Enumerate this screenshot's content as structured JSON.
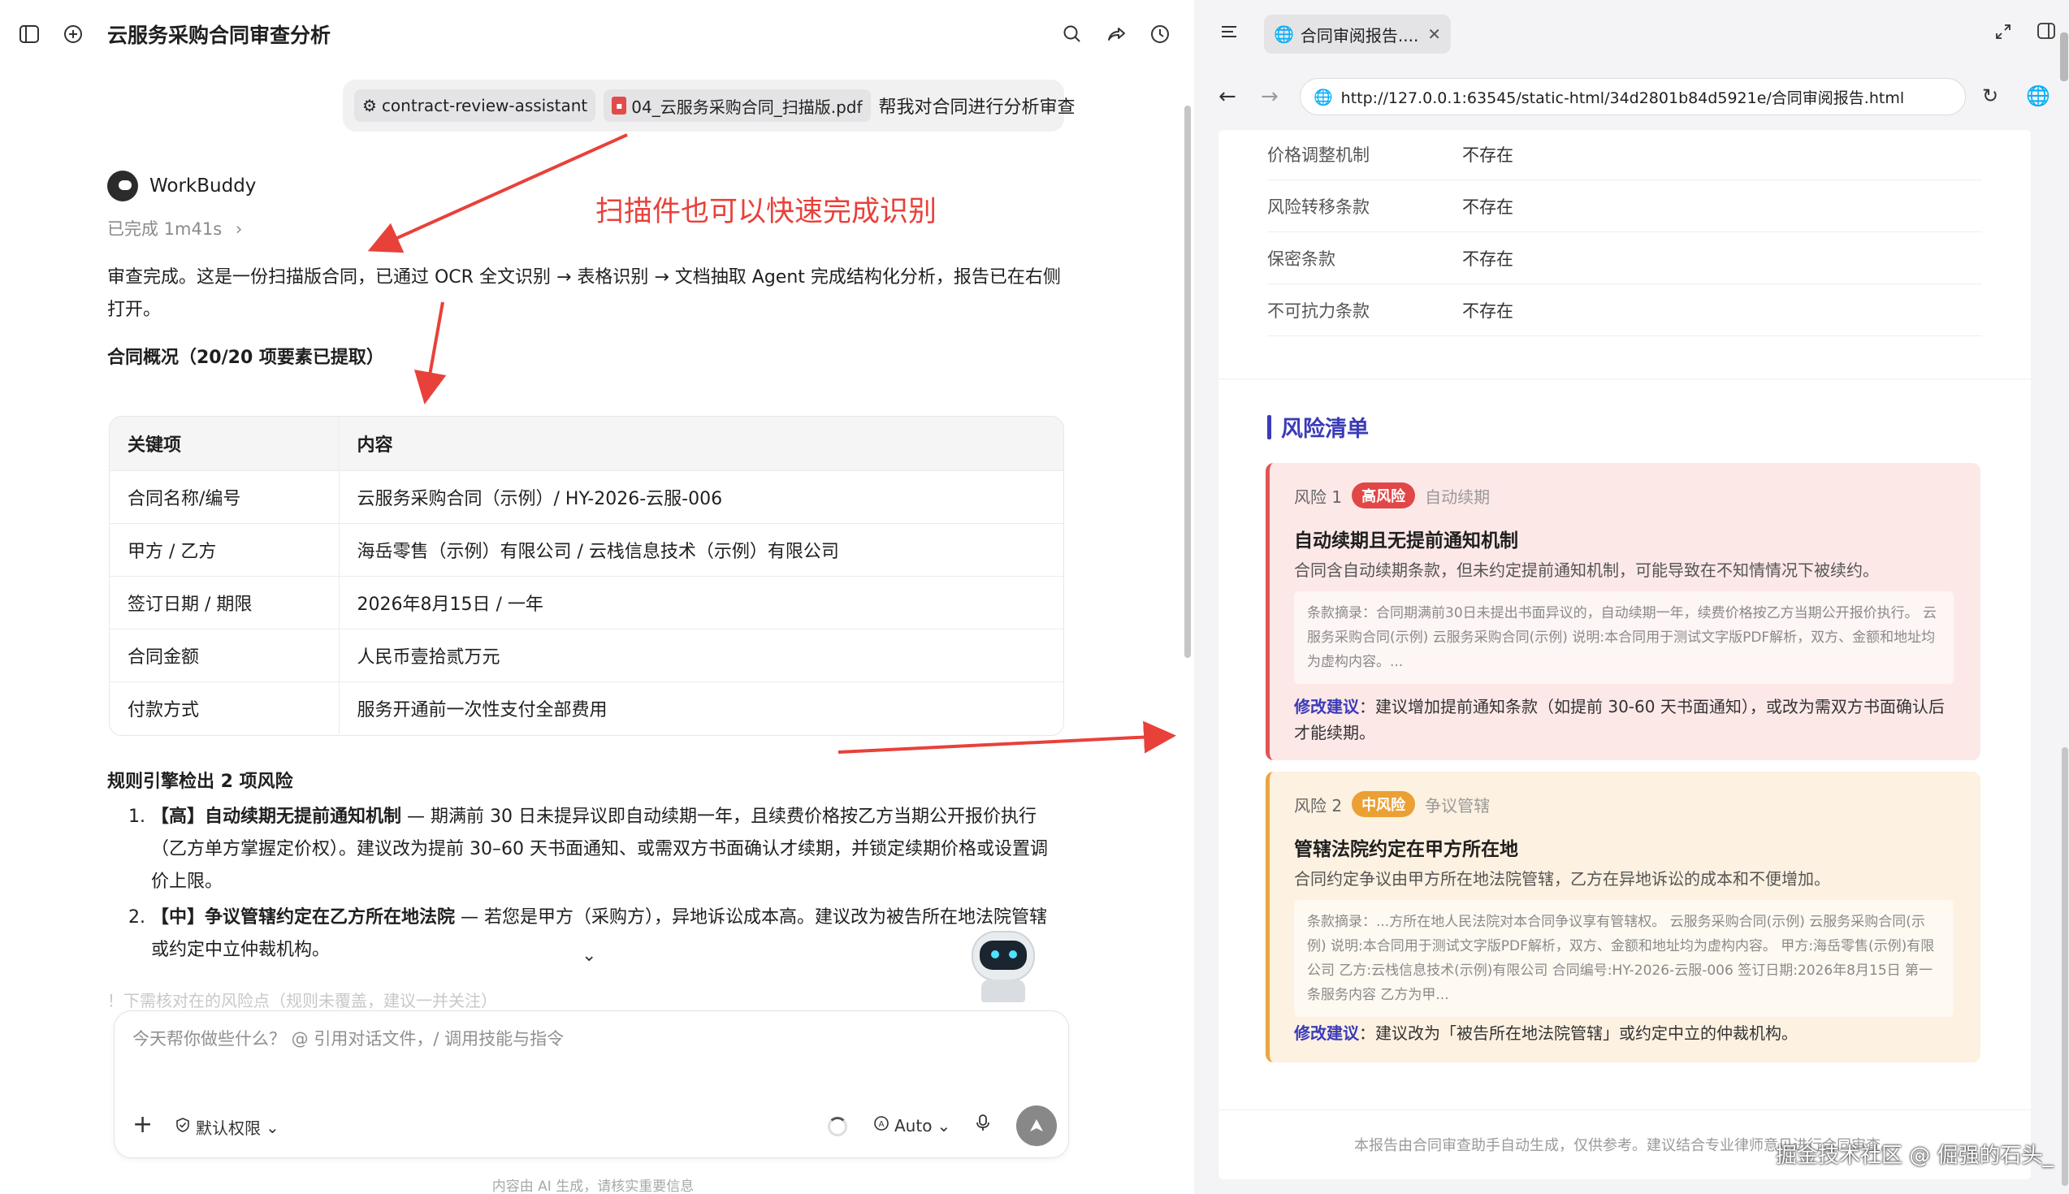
{
  "left": {
    "title": "云服务采购合同审查分析",
    "prompt": {
      "skill_chip": "contract-review-assistant",
      "file_chip": "04_云服务采购合同_扫描版.pdf",
      "text": "帮我对合同进行分析审查"
    },
    "agent": {
      "name": "WorkBuddy",
      "status": "已完成 1m41s",
      "chevron": "›"
    },
    "annotation": "扫描件也可以快速完成识别",
    "summary": "审查完成。这是一份扫描版合同，已通过 OCR 全文识别 → 表格识别 → 文档抽取 Agent 完成结构化分析，报告已在右侧打开。",
    "overview_heading": "合同概况（20/20 项要素已提取）",
    "table": {
      "headers": [
        "关键项",
        "内容"
      ],
      "rows": [
        [
          "合同名称/编号",
          "云服务采购合同（示例）/ HY-2026-云服-006"
        ],
        [
          "甲方 / 乙方",
          "海岳零售（示例）有限公司 / 云栈信息技术（示例）有限公司"
        ],
        [
          "签订日期 / 期限",
          "2026年8月15日 / 一年"
        ],
        [
          "合同金额",
          "人民币壹拾贰万元"
        ],
        [
          "付款方式",
          "服务开通前一次性支付全部费用"
        ]
      ]
    },
    "risk_heading": "规则引擎检出 2 项风险",
    "risks": [
      {
        "num": "1.",
        "bold": "【高】自动续期无提前通知机制",
        "text": " — 期满前 30 日未提异议即自动续期一年，且续费价格按乙方当期公开报价执行（乙方单方掌握定价权）。建议改为提前 30–60 天书面通知、或需双方书面确认才续期，并锁定续期价格或设置调价上限。"
      },
      {
        "num": "2.",
        "bold": "【中】争议管辖约定在乙方所在地法院",
        "text": " — 若您是甲方（采购方），异地诉讼成本高。建议改为被告所在地法院管辖或约定中立仲裁机构。"
      }
    ],
    "faded_line": "！下需核对在的风险点（规则未覆盖，建议一并关注）",
    "collapse_chevron": "⌄",
    "composer": {
      "placeholder": "今天帮你做些什么？ @ 引用对话文件，/ 调用技能与指令",
      "permission": "默认权限",
      "mode": "Auto"
    },
    "disclaimer": "内容由 AI 生成，请核实重要信息"
  },
  "right": {
    "tab_title": "合同审阅报告....",
    "url": "http://127.0.0.1:63545/static-html/34d2801b84d5921e/合同审阅报告.html",
    "kv_rows": [
      {
        "k": "价格调整机制",
        "v": "不存在"
      },
      {
        "k": "风险转移条款",
        "v": "不存在"
      },
      {
        "k": "保密条款",
        "v": "不存在"
      },
      {
        "k": "不可抗力条款",
        "v": "不存在"
      }
    ],
    "section_title": "风险清单",
    "cards": [
      {
        "label": "风险 1",
        "badge": "高风险",
        "category": "自动续期",
        "title": "自动续期且无提前通知机制",
        "desc": "合同含自动续期条款，但未约定提前通知机制，可能导致在不知情情况下被续约。",
        "excerpt": "条款摘录：合同期满前30日未提出书面异议的，自动续期一年，续费价格按乙方当期公开报价执行。 云服务采购合同(示例) 云服务采购合同(示例) 说明:本合同用于测试文字版PDF解析，双方、金额和地址均为虚构内容。...",
        "suggest_label": "修改建议",
        "suggest": "：建议增加提前通知条款（如提前 30-60 天书面通知），或改为需双方书面确认后才能续期。"
      },
      {
        "label": "风险 2",
        "badge": "中风险",
        "category": "争议管辖",
        "title": "管辖法院约定在甲方所在地",
        "desc": "合同约定争议由甲方所在地法院管辖，乙方在异地诉讼的成本和不便增加。",
        "excerpt": "条款摘录：...方所在地人民法院对本合同争议享有管辖权。 云服务采购合同(示例) 云服务采购合同(示例) 说明:本合同用于测试文字版PDF解析，双方、金额和地址均为虚构内容。 甲方:海岳零售(示例)有限公司 乙方:云栈信息技术(示例)有限公司 合同编号:HY-2026-云服-006 签订日期:2026年8月15日 第一条服务内容 乙方为甲...",
        "suggest_label": "修改建议",
        "suggest": "：建议改为「被告所在地法院管辖」或约定中立的仲裁机构。"
      }
    ],
    "footer": "本报告由合同审查助手自动生成，仅供参考。建议结合专业律师意见进行合同审查。"
  },
  "watermark": "掘金技术社区 @ 倔强的石头_",
  "colors": {
    "accent": "#3b3bb8",
    "annotation_red": "#e8413a",
    "high_risk": "#e14747",
    "mid_risk": "#eba034"
  }
}
